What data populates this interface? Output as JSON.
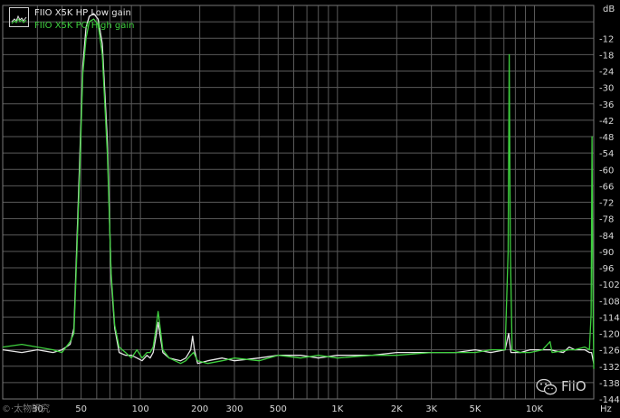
{
  "chart_data": {
    "type": "line",
    "xscale": "log",
    "xlim": [
      20,
      20000
    ],
    "ylim": [
      -144,
      0
    ],
    "grid": true,
    "legend_position": "top-left",
    "y_unit_label": "dB",
    "x_unit_label": "Hz",
    "x_ticks": [
      {
        "v": 30,
        "label": "30"
      },
      {
        "v": 50,
        "label": "50"
      },
      {
        "v": 100,
        "label": "100"
      },
      {
        "v": 200,
        "label": "200"
      },
      {
        "v": 300,
        "label": "300"
      },
      {
        "v": 500,
        "label": "500"
      },
      {
        "v": 1000,
        "label": "1K"
      },
      {
        "v": 2000,
        "label": "2K"
      },
      {
        "v": 3000,
        "label": "3K"
      },
      {
        "v": 5000,
        "label": "5K"
      },
      {
        "v": 10000,
        "label": "10K"
      }
    ],
    "y_ticks": [
      "-12",
      "-18",
      "-24",
      "-30",
      "-36",
      "-42",
      "-48",
      "-54",
      "-60",
      "-66",
      "-72",
      "-78",
      "-84",
      "-90",
      "-96",
      "-102",
      "-108",
      "-114",
      "-120",
      "-126",
      "-132",
      "-138",
      "-144"
    ],
    "series": [
      {
        "name": "FIIO X5K HP Low gain",
        "color": "#e6e6e6",
        "points": [
          [
            20,
            -126
          ],
          [
            25,
            -127
          ],
          [
            30,
            -126
          ],
          [
            36,
            -127
          ],
          [
            40,
            -126
          ],
          [
            44,
            -124
          ],
          [
            46,
            -118
          ],
          [
            49,
            -60
          ],
          [
            51,
            -22
          ],
          [
            53,
            -8
          ],
          [
            55,
            -4
          ],
          [
            58,
            -3
          ],
          [
            61,
            -5
          ],
          [
            64,
            -14
          ],
          [
            68,
            -50
          ],
          [
            71,
            -100
          ],
          [
            74,
            -118
          ],
          [
            78,
            -127
          ],
          [
            84,
            -128
          ],
          [
            90,
            -128
          ],
          [
            96,
            -129
          ],
          [
            102,
            -130
          ],
          [
            108,
            -128
          ],
          [
            112,
            -129
          ],
          [
            116,
            -127
          ],
          [
            120,
            -121
          ],
          [
            123,
            -116
          ],
          [
            126,
            -121
          ],
          [
            130,
            -127
          ],
          [
            140,
            -129
          ],
          [
            160,
            -130
          ],
          [
            170,
            -129
          ],
          [
            180,
            -126
          ],
          [
            184,
            -121
          ],
          [
            188,
            -126
          ],
          [
            195,
            -131
          ],
          [
            220,
            -130
          ],
          [
            260,
            -129
          ],
          [
            300,
            -130
          ],
          [
            400,
            -129
          ],
          [
            500,
            -128
          ],
          [
            650,
            -128
          ],
          [
            800,
            -129
          ],
          [
            1000,
            -128
          ],
          [
            1500,
            -128
          ],
          [
            2000,
            -127
          ],
          [
            3000,
            -127
          ],
          [
            4000,
            -127
          ],
          [
            5000,
            -126
          ],
          [
            6000,
            -127
          ],
          [
            7100,
            -126
          ],
          [
            7400,
            -120
          ],
          [
            7600,
            -127
          ],
          [
            8500,
            -127
          ],
          [
            9500,
            -126
          ],
          [
            12000,
            -126
          ],
          [
            14000,
            -127
          ],
          [
            15000,
            -125
          ],
          [
            16000,
            -126
          ],
          [
            18000,
            -126
          ],
          [
            19000,
            -127
          ],
          [
            19500,
            -127
          ],
          [
            20000,
            -131
          ]
        ]
      },
      {
        "name": "FIIO X5K PO High gain",
        "color": "#3ecf3e",
        "points": [
          [
            20,
            -125
          ],
          [
            25,
            -124
          ],
          [
            30,
            -125
          ],
          [
            36,
            -126
          ],
          [
            40,
            -127
          ],
          [
            44,
            -123
          ],
          [
            46,
            -120
          ],
          [
            49,
            -65
          ],
          [
            51,
            -25
          ],
          [
            53,
            -12
          ],
          [
            55,
            -6
          ],
          [
            58,
            -5
          ],
          [
            61,
            -7
          ],
          [
            64,
            -18
          ],
          [
            68,
            -55
          ],
          [
            71,
            -98
          ],
          [
            74,
            -117
          ],
          [
            78,
            -125
          ],
          [
            84,
            -127
          ],
          [
            90,
            -129
          ],
          [
            96,
            -126
          ],
          [
            102,
            -129
          ],
          [
            108,
            -127
          ],
          [
            112,
            -127
          ],
          [
            116,
            -125
          ],
          [
            120,
            -118
          ],
          [
            123,
            -112
          ],
          [
            126,
            -118
          ],
          [
            130,
            -126
          ],
          [
            140,
            -129
          ],
          [
            160,
            -131
          ],
          [
            170,
            -130
          ],
          [
            180,
            -128
          ],
          [
            186,
            -127
          ],
          [
            195,
            -130
          ],
          [
            220,
            -131
          ],
          [
            260,
            -130
          ],
          [
            300,
            -129
          ],
          [
            400,
            -130
          ],
          [
            500,
            -128
          ],
          [
            650,
            -129
          ],
          [
            800,
            -128
          ],
          [
            1000,
            -129
          ],
          [
            1500,
            -128
          ],
          [
            2000,
            -128
          ],
          [
            3000,
            -127
          ],
          [
            4000,
            -127
          ],
          [
            5000,
            -127
          ],
          [
            6000,
            -126
          ],
          [
            7100,
            -126
          ],
          [
            7350,
            -90
          ],
          [
            7450,
            -18
          ],
          [
            7550,
            -90
          ],
          [
            7700,
            -126
          ],
          [
            8500,
            -127
          ],
          [
            9500,
            -127
          ],
          [
            11000,
            -126
          ],
          [
            12000,
            -123
          ],
          [
            12300,
            -127
          ],
          [
            15000,
            -126
          ],
          [
            16000,
            -126
          ],
          [
            18000,
            -125
          ],
          [
            19000,
            -126
          ],
          [
            19400,
            -113
          ],
          [
            19600,
            -48
          ],
          [
            19800,
            -100
          ],
          [
            20000,
            -133
          ]
        ]
      }
    ]
  },
  "watermark_right": "FiiO",
  "watermark_left": "©·太物研究"
}
